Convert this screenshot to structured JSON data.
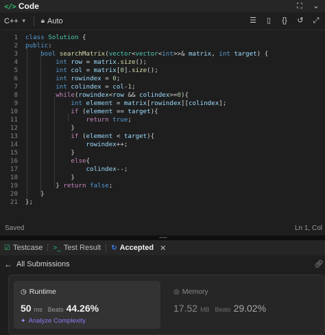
{
  "titlebar": {
    "icon": "</>",
    "title": "Code"
  },
  "toolbar": {
    "language": "C++",
    "mode": "Auto"
  },
  "editor": {
    "line_numbers": [
      "1",
      "2",
      "3",
      "4",
      "5",
      "6",
      "7",
      "8",
      "9",
      "10",
      "11",
      "12",
      "13",
      "14",
      "15",
      "16",
      "17",
      "18",
      "19",
      "20",
      "21"
    ]
  },
  "status": {
    "saved": "Saved",
    "position": "Ln 1, Col"
  },
  "panel": {
    "tabs": [
      {
        "label": "Testcase"
      },
      {
        "label": "Test Result"
      },
      {
        "label": "Accepted"
      }
    ]
  },
  "submissions": {
    "back_label": "All Submissions"
  },
  "runtime": {
    "label": "Runtime",
    "value": "50",
    "unit": "ms",
    "beats_label": "Beats",
    "beats": "44.26%",
    "analyze_label": "Analyze Complexity"
  },
  "memory": {
    "label": "Memory",
    "value": "17.52",
    "unit": "MB",
    "beats_label": "Beats",
    "beats": "29.02%"
  },
  "colors": {
    "accent_green": "#2dbd6e",
    "accepted_blue": "#3b82f6",
    "analyze_purple": "#8b7cf6"
  }
}
